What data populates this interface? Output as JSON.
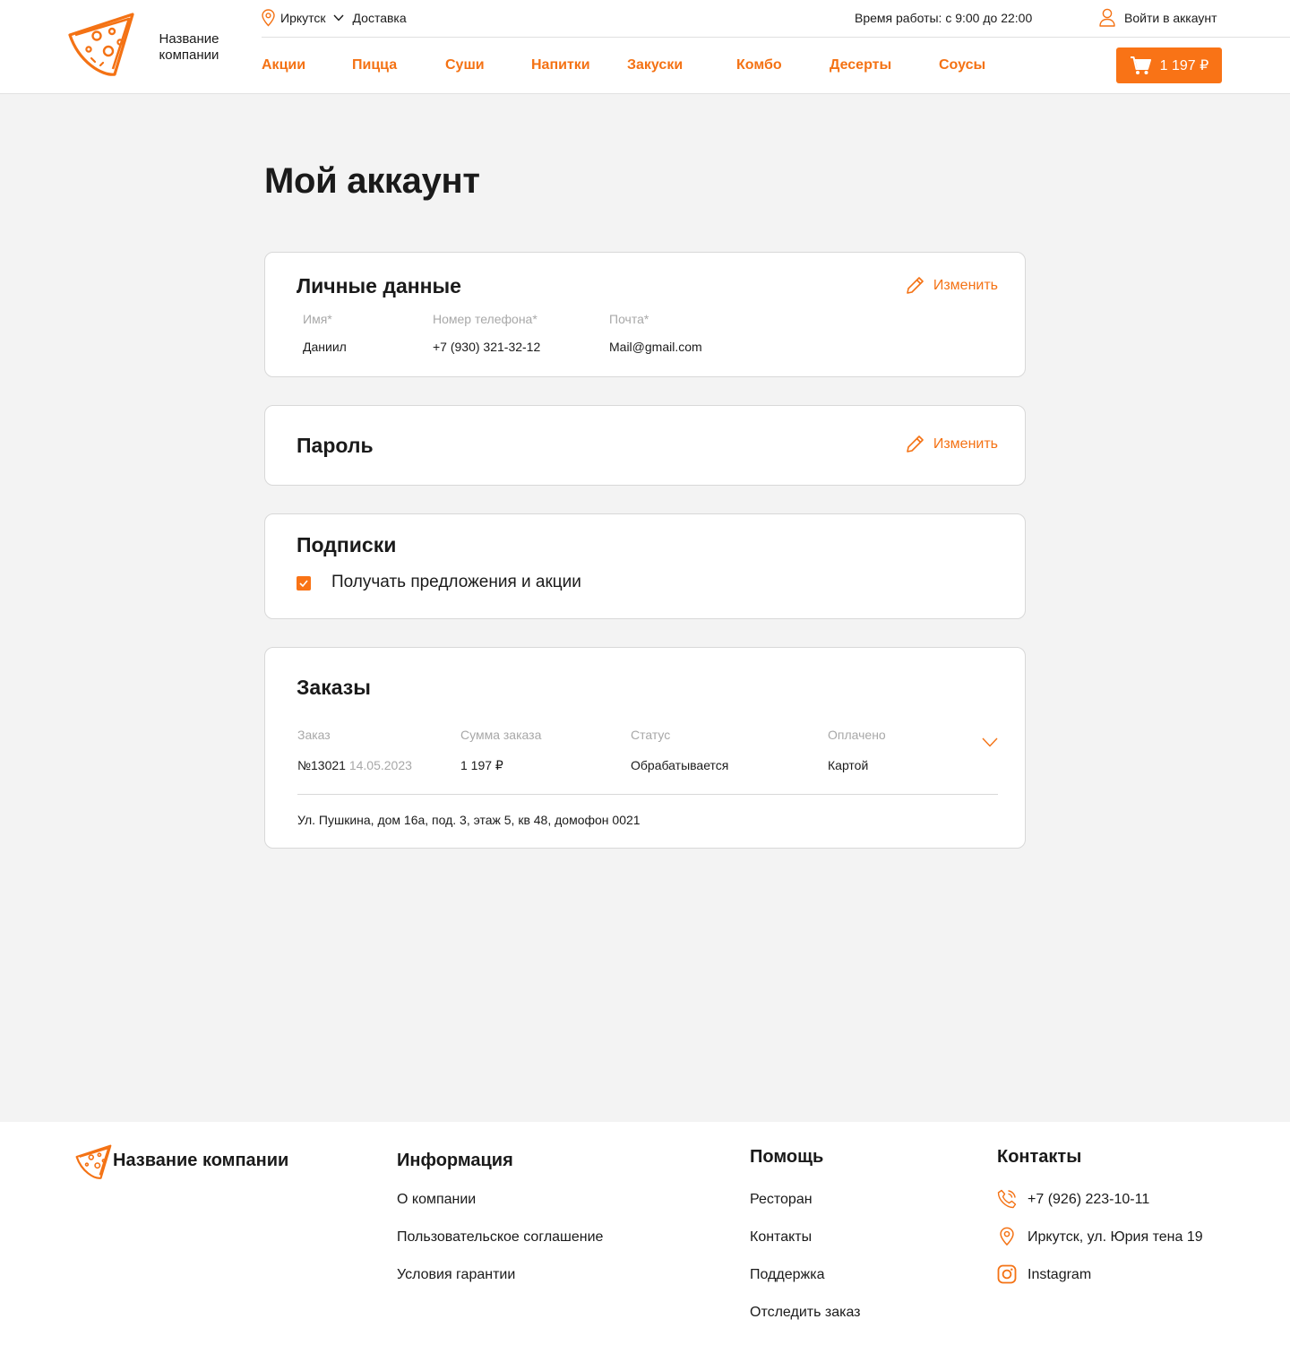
{
  "header": {
    "company_name": "Название компании",
    "city": "Иркутск",
    "delivery": "Доставка",
    "hours": "Время работы: с 9:00 до 22:00",
    "login": "Войти в аккаунт",
    "cart_total": "1 197 ₽",
    "nav": [
      "Акции",
      "Пицца",
      "Суши",
      "Напитки",
      "Закуски",
      "Комбо",
      "Десерты",
      "Соусы"
    ]
  },
  "colors": {
    "accent": "#f97316",
    "accent_text": "#f47214",
    "page_bg": "#f3f3f3",
    "muted": "#a8a8a8"
  },
  "main": {
    "title": "Мой аккаунт",
    "personal": {
      "title": "Личные данные",
      "edit": "Изменить",
      "name_label": "Имя*",
      "name_value": "Даниил",
      "phone_label": "Номер телефона*",
      "phone_value": "+7 (930) 321-32-12",
      "email_label": "Почта*",
      "email_value": "Mail@gmail.com"
    },
    "password": {
      "title": "Пароль",
      "edit": "Изменить"
    },
    "subscriptions": {
      "title": "Подписки",
      "checkbox_label": "Получать предложения и акции",
      "checked": true
    },
    "orders": {
      "title": "Заказы",
      "columns": [
        "Заказ",
        "Сумма заказа",
        "Статус",
        "Оплачено"
      ],
      "order_number": "№13021",
      "order_date": "14.05.2023",
      "sum": "1 197 ₽",
      "status": "Обрабатывается",
      "paid": "Картой",
      "address": "Ул. Пушкина, дом 16а, под. 3, этаж 5, кв 48, домофон 0021"
    }
  },
  "footer": {
    "company_name": "Название компании",
    "info": {
      "title": "Информация",
      "links": [
        "О компании",
        "Пользовательское соглашение",
        "Условия гарантии"
      ]
    },
    "help": {
      "title": "Помощь",
      "links": [
        "Ресторан",
        "Контакты",
        "Поддержка",
        "Отследить заказ"
      ]
    },
    "contacts": {
      "title": "Контакты",
      "phone": "+7 (926) 223-10-11",
      "address": "Иркутск, ул. Юрия тена 19",
      "instagram": "Instagram"
    }
  }
}
